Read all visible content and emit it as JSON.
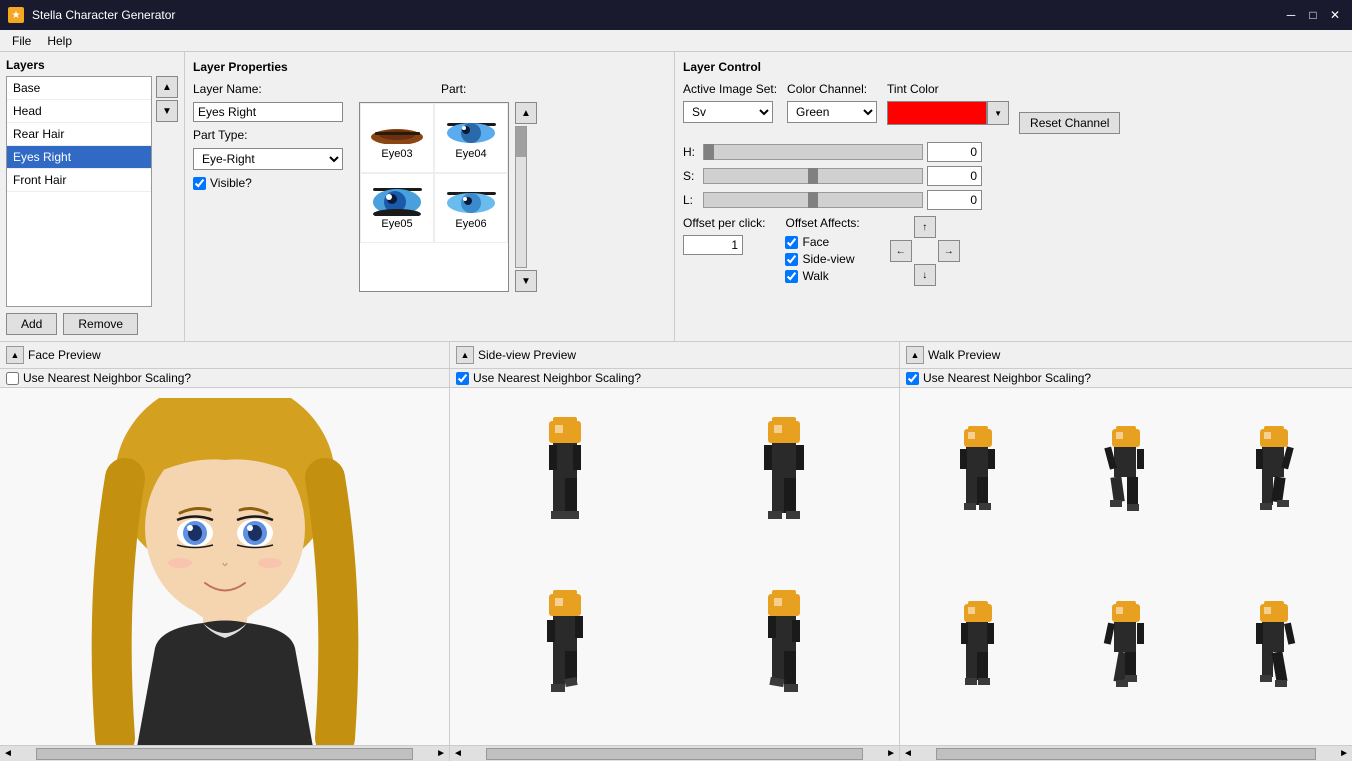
{
  "titleBar": {
    "appName": "Stella Character Generator",
    "minimize": "─",
    "maximize": "□",
    "close": "✕"
  },
  "menuBar": {
    "file": "File",
    "help": "Help"
  },
  "layersPanel": {
    "title": "Layers",
    "items": [
      {
        "label": "Base",
        "selected": false
      },
      {
        "label": "Head",
        "selected": false
      },
      {
        "label": "Rear Hair",
        "selected": false
      },
      {
        "label": "Eyes Right",
        "selected": true
      },
      {
        "label": "Front Hair",
        "selected": false
      }
    ],
    "addBtn": "Add",
    "removeBtn": "Remove"
  },
  "layerProps": {
    "title": "Layer Properties",
    "layerNameLabel": "Layer Name:",
    "layerNameValue": "Eyes Right",
    "partLabel": "Part:",
    "partTypeLabel": "Part Type:",
    "partTypeValue": "Eye-Right",
    "visibleLabel": "Visible?",
    "parts": [
      {
        "id": "Eye03",
        "label": "Eye03"
      },
      {
        "id": "Eye04",
        "label": "Eye04"
      },
      {
        "id": "Eye05",
        "label": "Eye05"
      },
      {
        "id": "Eye06",
        "label": "Eye06"
      }
    ]
  },
  "layerControl": {
    "title": "Layer Control",
    "activeImageSetLabel": "Active Image Set:",
    "activeImageSetValue": "Sv",
    "colorChannelLabel": "Color Channel:",
    "colorChannelValue": "Green",
    "tintColorLabel": "Tint Color",
    "tintColor": "#ff0000",
    "resetChannelBtn": "Reset Channel",
    "hLabel": "H:",
    "hValue": "0",
    "sLabel": "S:",
    "sValue": "0",
    "lLabel": "L:",
    "lValue": "0",
    "offsetPerClickLabel": "Offset per click:",
    "offsetPerClickValue": "1",
    "offsetAffectsLabel": "Offset Affects:",
    "offsetAffectsFace": "Face",
    "offsetAffectsSideview": "Side-view",
    "offsetAffectsWalk": "Walk",
    "navUp": "↑",
    "navDown": "↓",
    "navLeft": "←",
    "navRight": "→"
  },
  "facePrev": {
    "title": "Face Preview",
    "nearestNeighbor": "Use Nearest Neighbor Scaling?"
  },
  "sideviewPrev": {
    "title": "Side-view Preview",
    "nearestNeighbor": "Use Nearest Neighbor Scaling?",
    "checked": true
  },
  "walkPrev": {
    "title": "Walk Preview",
    "nearestNeighbor": "Use Nearest Neighbor Scaling?",
    "checked": true
  }
}
